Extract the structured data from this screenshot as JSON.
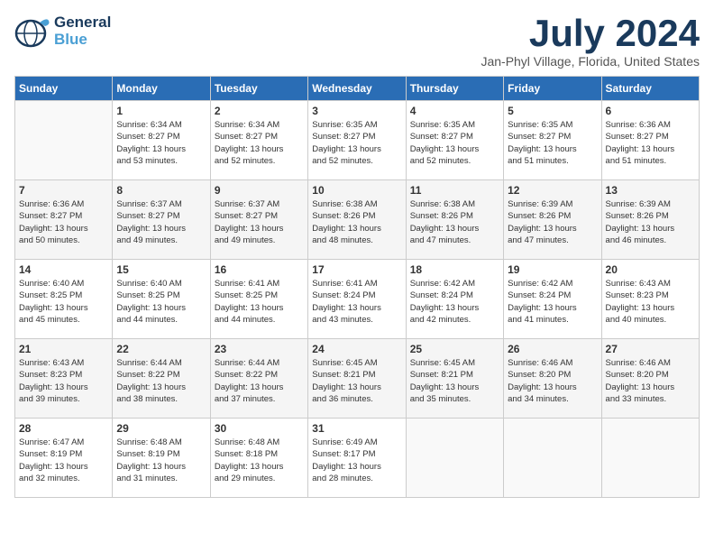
{
  "header": {
    "logo_line1": "General",
    "logo_line2": "Blue",
    "month": "July 2024",
    "location": "Jan-Phyl Village, Florida, United States"
  },
  "weekdays": [
    "Sunday",
    "Monday",
    "Tuesday",
    "Wednesday",
    "Thursday",
    "Friday",
    "Saturday"
  ],
  "weeks": [
    [
      {
        "day": "",
        "info": ""
      },
      {
        "day": "1",
        "info": "Sunrise: 6:34 AM\nSunset: 8:27 PM\nDaylight: 13 hours\nand 53 minutes."
      },
      {
        "day": "2",
        "info": "Sunrise: 6:34 AM\nSunset: 8:27 PM\nDaylight: 13 hours\nand 52 minutes."
      },
      {
        "day": "3",
        "info": "Sunrise: 6:35 AM\nSunset: 8:27 PM\nDaylight: 13 hours\nand 52 minutes."
      },
      {
        "day": "4",
        "info": "Sunrise: 6:35 AM\nSunset: 8:27 PM\nDaylight: 13 hours\nand 52 minutes."
      },
      {
        "day": "5",
        "info": "Sunrise: 6:35 AM\nSunset: 8:27 PM\nDaylight: 13 hours\nand 51 minutes."
      },
      {
        "day": "6",
        "info": "Sunrise: 6:36 AM\nSunset: 8:27 PM\nDaylight: 13 hours\nand 51 minutes."
      }
    ],
    [
      {
        "day": "7",
        "info": "Sunrise: 6:36 AM\nSunset: 8:27 PM\nDaylight: 13 hours\nand 50 minutes."
      },
      {
        "day": "8",
        "info": "Sunrise: 6:37 AM\nSunset: 8:27 PM\nDaylight: 13 hours\nand 49 minutes."
      },
      {
        "day": "9",
        "info": "Sunrise: 6:37 AM\nSunset: 8:27 PM\nDaylight: 13 hours\nand 49 minutes."
      },
      {
        "day": "10",
        "info": "Sunrise: 6:38 AM\nSunset: 8:26 PM\nDaylight: 13 hours\nand 48 minutes."
      },
      {
        "day": "11",
        "info": "Sunrise: 6:38 AM\nSunset: 8:26 PM\nDaylight: 13 hours\nand 47 minutes."
      },
      {
        "day": "12",
        "info": "Sunrise: 6:39 AM\nSunset: 8:26 PM\nDaylight: 13 hours\nand 47 minutes."
      },
      {
        "day": "13",
        "info": "Sunrise: 6:39 AM\nSunset: 8:26 PM\nDaylight: 13 hours\nand 46 minutes."
      }
    ],
    [
      {
        "day": "14",
        "info": "Sunrise: 6:40 AM\nSunset: 8:25 PM\nDaylight: 13 hours\nand 45 minutes."
      },
      {
        "day": "15",
        "info": "Sunrise: 6:40 AM\nSunset: 8:25 PM\nDaylight: 13 hours\nand 44 minutes."
      },
      {
        "day": "16",
        "info": "Sunrise: 6:41 AM\nSunset: 8:25 PM\nDaylight: 13 hours\nand 44 minutes."
      },
      {
        "day": "17",
        "info": "Sunrise: 6:41 AM\nSunset: 8:24 PM\nDaylight: 13 hours\nand 43 minutes."
      },
      {
        "day": "18",
        "info": "Sunrise: 6:42 AM\nSunset: 8:24 PM\nDaylight: 13 hours\nand 42 minutes."
      },
      {
        "day": "19",
        "info": "Sunrise: 6:42 AM\nSunset: 8:24 PM\nDaylight: 13 hours\nand 41 minutes."
      },
      {
        "day": "20",
        "info": "Sunrise: 6:43 AM\nSunset: 8:23 PM\nDaylight: 13 hours\nand 40 minutes."
      }
    ],
    [
      {
        "day": "21",
        "info": "Sunrise: 6:43 AM\nSunset: 8:23 PM\nDaylight: 13 hours\nand 39 minutes."
      },
      {
        "day": "22",
        "info": "Sunrise: 6:44 AM\nSunset: 8:22 PM\nDaylight: 13 hours\nand 38 minutes."
      },
      {
        "day": "23",
        "info": "Sunrise: 6:44 AM\nSunset: 8:22 PM\nDaylight: 13 hours\nand 37 minutes."
      },
      {
        "day": "24",
        "info": "Sunrise: 6:45 AM\nSunset: 8:21 PM\nDaylight: 13 hours\nand 36 minutes."
      },
      {
        "day": "25",
        "info": "Sunrise: 6:45 AM\nSunset: 8:21 PM\nDaylight: 13 hours\nand 35 minutes."
      },
      {
        "day": "26",
        "info": "Sunrise: 6:46 AM\nSunset: 8:20 PM\nDaylight: 13 hours\nand 34 minutes."
      },
      {
        "day": "27",
        "info": "Sunrise: 6:46 AM\nSunset: 8:20 PM\nDaylight: 13 hours\nand 33 minutes."
      }
    ],
    [
      {
        "day": "28",
        "info": "Sunrise: 6:47 AM\nSunset: 8:19 PM\nDaylight: 13 hours\nand 32 minutes."
      },
      {
        "day": "29",
        "info": "Sunrise: 6:48 AM\nSunset: 8:19 PM\nDaylight: 13 hours\nand 31 minutes."
      },
      {
        "day": "30",
        "info": "Sunrise: 6:48 AM\nSunset: 8:18 PM\nDaylight: 13 hours\nand 29 minutes."
      },
      {
        "day": "31",
        "info": "Sunrise: 6:49 AM\nSunset: 8:17 PM\nDaylight: 13 hours\nand 28 minutes."
      },
      {
        "day": "",
        "info": ""
      },
      {
        "day": "",
        "info": ""
      },
      {
        "day": "",
        "info": ""
      }
    ]
  ]
}
